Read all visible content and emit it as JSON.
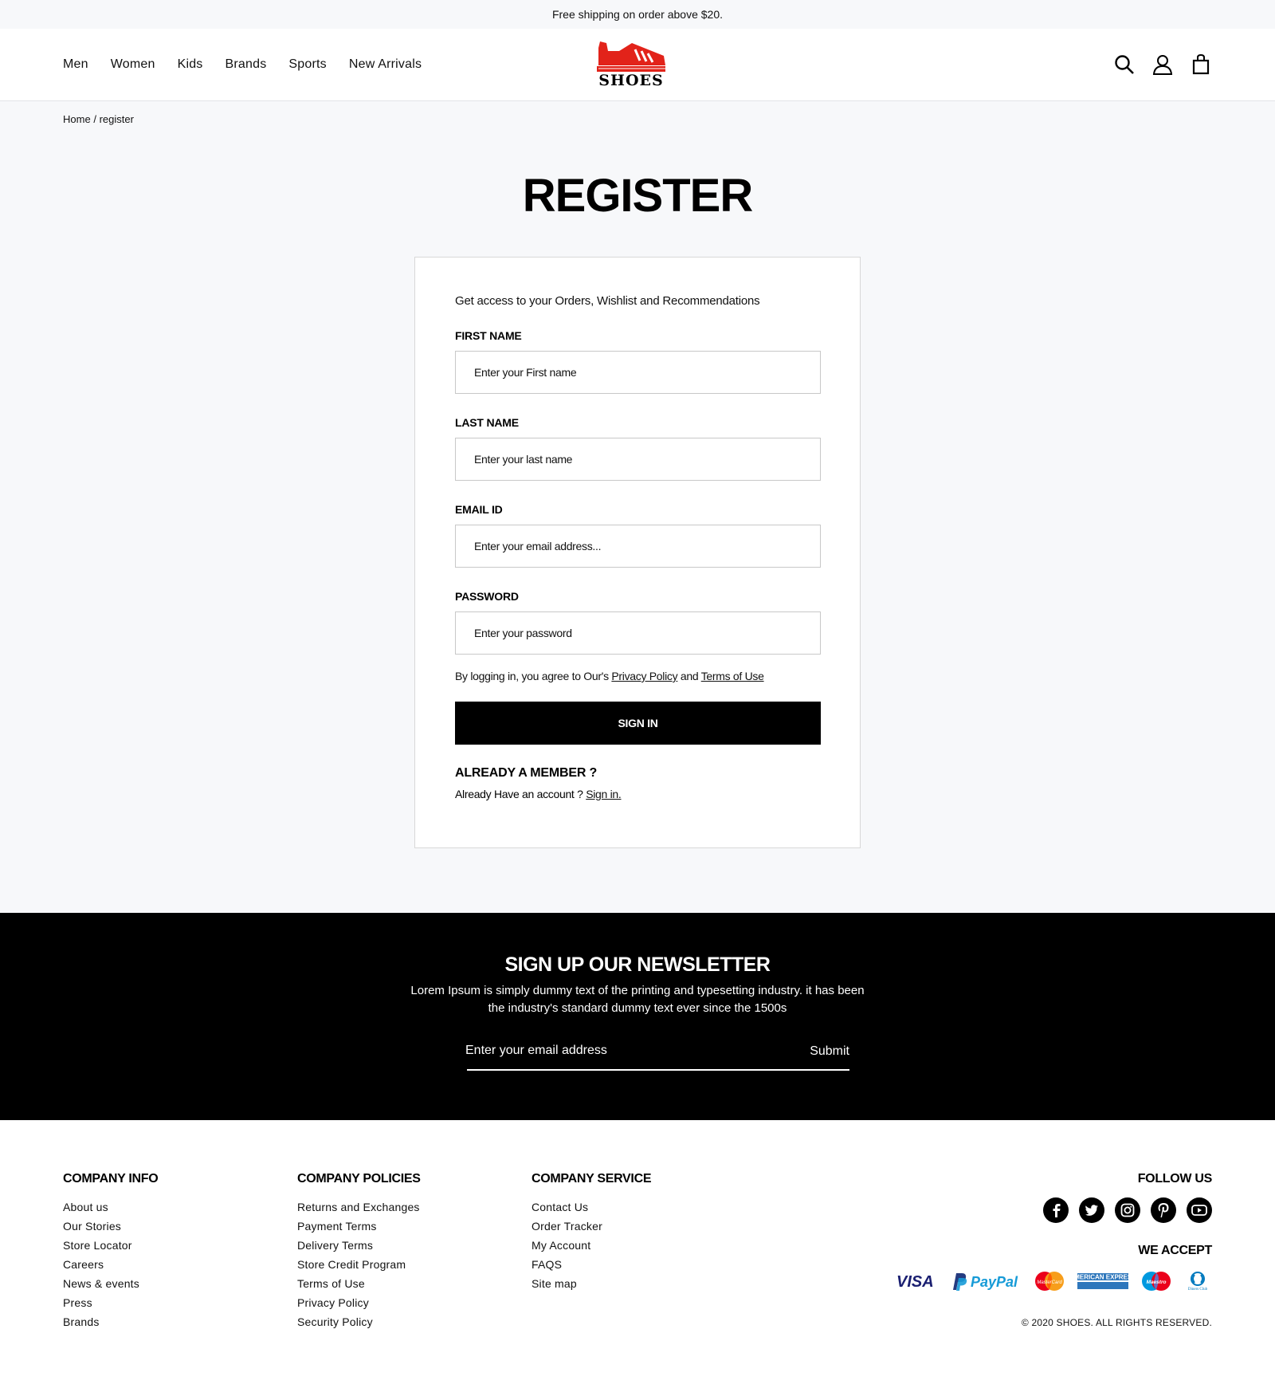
{
  "topbar": {
    "text": "Free shipping on order above $20."
  },
  "nav": {
    "items": [
      {
        "label": "Men"
      },
      {
        "label": "Women"
      },
      {
        "label": "Kids"
      },
      {
        "label": "Brands"
      },
      {
        "label": "Sports"
      },
      {
        "label": "New Arrivals"
      }
    ]
  },
  "logo": {
    "text": "SHOES",
    "color": "#e2231a"
  },
  "header_icons": [
    "search-icon",
    "user-icon",
    "bag-icon"
  ],
  "breadcrumb": {
    "home": "Home",
    "separator": "/",
    "current": "register"
  },
  "page": {
    "title": "REGISTER"
  },
  "form": {
    "intro": "Get access to your Orders, Wishlist and Recommendations",
    "first_name_label": "FIRST NAME",
    "first_name_placeholder": "Enter your First name",
    "last_name_label": "LAST NAME",
    "last_name_placeholder": "Enter your last name",
    "email_label": "EMAIL ID",
    "email_placeholder": "Enter your email address...",
    "password_label": "PASSWORD",
    "password_placeholder": "Enter your password",
    "agree_prefix": "By logging in, you agree to Our's",
    "privacy_link": "Privacy Policy",
    "agree_and": "and",
    "terms_link": "Terms of Use",
    "submit_label": "SIGN IN",
    "member_title": "ALREADY A MEMBER ?",
    "member_text": "Already Have an account ?",
    "member_link": "Sign in."
  },
  "newsletter": {
    "title": "SIGN UP OUR NEWSLETTER",
    "description": "Lorem Ipsum is simply dummy text of the printing and typesetting industry. it has been the industry's standard dummy text ever since the 1500s",
    "placeholder": "Enter your email address",
    "submit_label": "Submit"
  },
  "footer": {
    "company_info": {
      "title": "COMPANY INFO",
      "links": [
        "About us",
        "Our Stories",
        "Store Locator",
        "Careers",
        "News & events",
        "Press",
        "Brands"
      ]
    },
    "company_policies": {
      "title": "COMPANY POLICIES",
      "links": [
        "Returns and Exchanges",
        "Payment Terms",
        "Delivery Terms",
        "Store Credit Program",
        "Terms of Use",
        "Privacy Policy",
        "Security Policy"
      ]
    },
    "company_service": {
      "title": "COMPANY SERVICE",
      "links": [
        "Contact Us",
        "Order Tracker",
        "My Account",
        "FAQS",
        "Site map"
      ]
    },
    "follow_title": "FOLLOW US",
    "socials": [
      "facebook-icon",
      "twitter-icon",
      "instagram-icon",
      "pinterest-icon",
      "youtube-icon"
    ],
    "accept_title": "WE ACCEPT",
    "payment_cards": [
      {
        "name": "visa-icon",
        "text": "VISA"
      },
      {
        "name": "paypal-icon",
        "text": "PayPal"
      },
      {
        "name": "mastercard-icon",
        "text": "MasterCard"
      },
      {
        "name": "amex-icon",
        "text": "AMERICAN EXPRESS"
      },
      {
        "name": "maestro-icon",
        "text": "Maestro"
      },
      {
        "name": "diners-club-icon",
        "text": "Diners Club"
      }
    ],
    "copyright": "© 2020 SHOES. ALL RIGHTS RESERVED."
  }
}
